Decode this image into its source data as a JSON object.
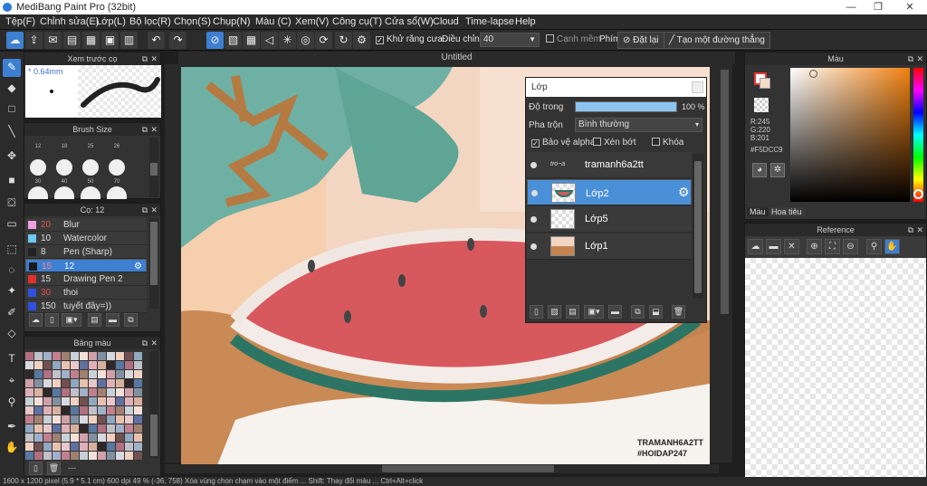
{
  "window": {
    "title": "MediBang Paint Pro (32bit)",
    "minimize": "—",
    "maximize": "❐",
    "close": "✕"
  },
  "menu": [
    "Tệp(F)",
    "Chỉnh sửa(E)",
    "Lớp(L)",
    "Bộ lọc(R)",
    "Chọn(S)",
    "Chụp(N)",
    "Màu (C)",
    "Xem(V)",
    "Công cụ(T)",
    "Cửa sổ(W)",
    "Cloud",
    "Time-lapse",
    "Help"
  ],
  "toolbar": {
    "antialias_label": "Khử răng cưa",
    "adjust_label": "Điều chỉnh",
    "adjust_value": "40",
    "snap_label": "Cạnh mềm",
    "key_label": "Phím",
    "reset_label": "Đặt lại",
    "new_line_label": "Tạo một đường thẳng"
  },
  "preview_panel": {
    "title": "Xem trước cọ",
    "size": "* 0.64mm"
  },
  "brush_size_panel": {
    "title": "Brush Size",
    "row1": [
      "12",
      "18",
      "25",
      "26"
    ],
    "row2": [
      "30",
      "40",
      "50",
      "70"
    ]
  },
  "brush_panel": {
    "title": "Cọ: 12",
    "brushes": [
      {
        "size": "20",
        "name": "Blur",
        "color": "#f0a0e0",
        "num_color": "#e05050"
      },
      {
        "size": "10",
        "name": "Watercolor",
        "color": "#70c8f0",
        "num_color": "#dddddd"
      },
      {
        "size": "8",
        "name": "Pen (Sharp)",
        "color": "#222222",
        "num_color": "#dddddd"
      },
      {
        "size": "15",
        "name": "12",
        "color": "#1a1a1a",
        "num_color": "#e05050"
      },
      {
        "size": "15",
        "name": "Drawing Pen 2",
        "color": "#e03030",
        "num_color": "#dddddd"
      },
      {
        "size": "30",
        "name": "thoi",
        "color": "#3050e0",
        "num_color": "#e05050"
      },
      {
        "size": "150",
        "name": "tuyết đây=))",
        "color": "#3050e0",
        "num_color": "#dddddd"
      }
    ]
  },
  "palette_panel": {
    "title": "Bảng màu",
    "footer": "---"
  },
  "canvas": {
    "tab": "Untitled",
    "signature": [
      "TRAMANH6A2TT",
      "#HOIDAP247"
    ]
  },
  "layer_panel": {
    "title": "Lớp",
    "opacity_label": "Độ trong",
    "opacity_value": "100 %",
    "opacity_fraction": 1.0,
    "blend_label": "Pha trộn",
    "blend_value": "Bình thường",
    "protect_alpha": "Bảo vệ alpha",
    "clip": "Xén bớt",
    "lock": "Khóa",
    "layers": [
      {
        "name": "tramanh6a2tt",
        "selected": false
      },
      {
        "name": "Lớp2",
        "selected": true
      },
      {
        "name": "Lớp5",
        "selected": false
      },
      {
        "name": "Lớp1",
        "selected": false
      }
    ]
  },
  "color_panel": {
    "title": "Màu",
    "r": "R:245",
    "g": "G:220",
    "b": "B:201",
    "hex": "#F5DCC9",
    "current": "#F5DCC9",
    "tab_color": "Màu",
    "tab_texture": "Hoa tiêu"
  },
  "reference_panel": {
    "title": "Reference"
  },
  "status": "1600 x 1200 pixel (5.9 * 5.1 cm)   600 dpi   49 %   (-36, 758)   Xóa vùng chọn chạm vào một điểm ... Shift: Thay đổi màu ... Ctrl+Alt+click"
}
